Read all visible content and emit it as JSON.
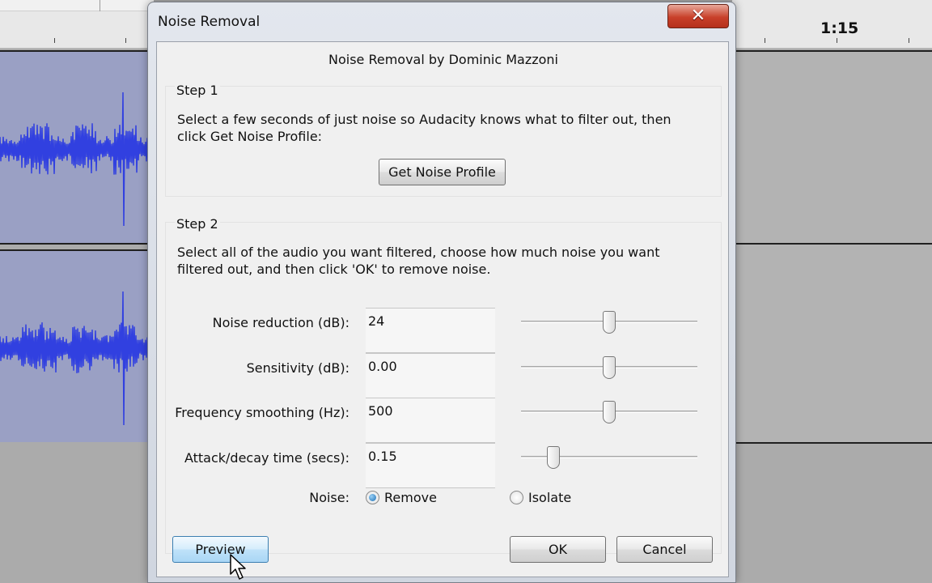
{
  "background": {
    "timeline_label": "1:15",
    "waveform_color": "#3140e0",
    "track_color": "#9aa0c4"
  },
  "dialog": {
    "title": "Noise Removal",
    "close_label": "✕",
    "subtitle": "Noise Removal by Dominic Mazzoni",
    "step1": {
      "label": "Step 1",
      "text": "Select a few seconds of just noise so Audacity knows what to filter out, then click Get Noise Profile:",
      "button": "Get Noise Profile"
    },
    "step2": {
      "label": "Step 2",
      "text": "Select all of the audio you want filtered, choose how much noise you want filtered out, and then click 'OK' to remove noise.",
      "params": [
        {
          "label": "Noise reduction (dB):",
          "value": "24",
          "slider_fraction": 0.5
        },
        {
          "label": "Sensitivity (dB):",
          "value": "0.00",
          "slider_fraction": 0.5
        },
        {
          "label": "Frequency smoothing (Hz):",
          "value": "500",
          "slider_fraction": 0.5
        },
        {
          "label": "Attack/decay time (secs):",
          "value": "0.15",
          "slider_fraction": 0.16
        }
      ],
      "noise_label": "Noise:",
      "noise_options": [
        {
          "label": "Remove",
          "selected": true
        },
        {
          "label": "Isolate",
          "selected": false
        }
      ]
    },
    "buttons": {
      "preview": "Preview",
      "ok": "OK",
      "cancel": "Cancel"
    }
  }
}
